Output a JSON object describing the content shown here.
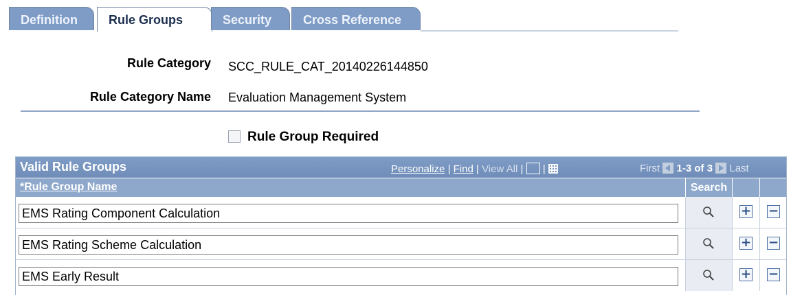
{
  "tabs": [
    {
      "label": "Definition",
      "active": false
    },
    {
      "label": "Rule Groups",
      "active": true
    },
    {
      "label": "Security",
      "active": false
    },
    {
      "label": "Cross Reference",
      "active": false
    }
  ],
  "fields": {
    "rule_category_label": "Rule Category",
    "rule_category_value": "SCC_RULE_CAT_20140226144850",
    "rule_category_name_label": "Rule Category Name",
    "rule_category_name_value": "Evaluation Management System"
  },
  "checkbox": {
    "label": "Rule Group Required",
    "checked": false
  },
  "grid": {
    "title": "Valid Rule Groups",
    "links": {
      "personalize": "Personalize",
      "sep1": "|",
      "find": "Find",
      "sep2": "|",
      "view_all": "View All",
      "sep3": "|",
      "sep4": "|"
    },
    "pager": {
      "first": "First",
      "range": "1-3 of 3",
      "last": "Last"
    },
    "columns": {
      "name": "*Rule Group Name",
      "search": "Search"
    },
    "rows": [
      {
        "name": "EMS Rating Component Calculation"
      },
      {
        "name": "EMS Rating Scheme Calculation"
      },
      {
        "name": "EMS Early Result"
      }
    ],
    "add_symbol": "+",
    "delete_symbol": "−"
  },
  "colors": {
    "tab_inactive": "#7f9cc6",
    "grid_header": "#7f9cc6",
    "column_header": "#8ea8cc"
  }
}
